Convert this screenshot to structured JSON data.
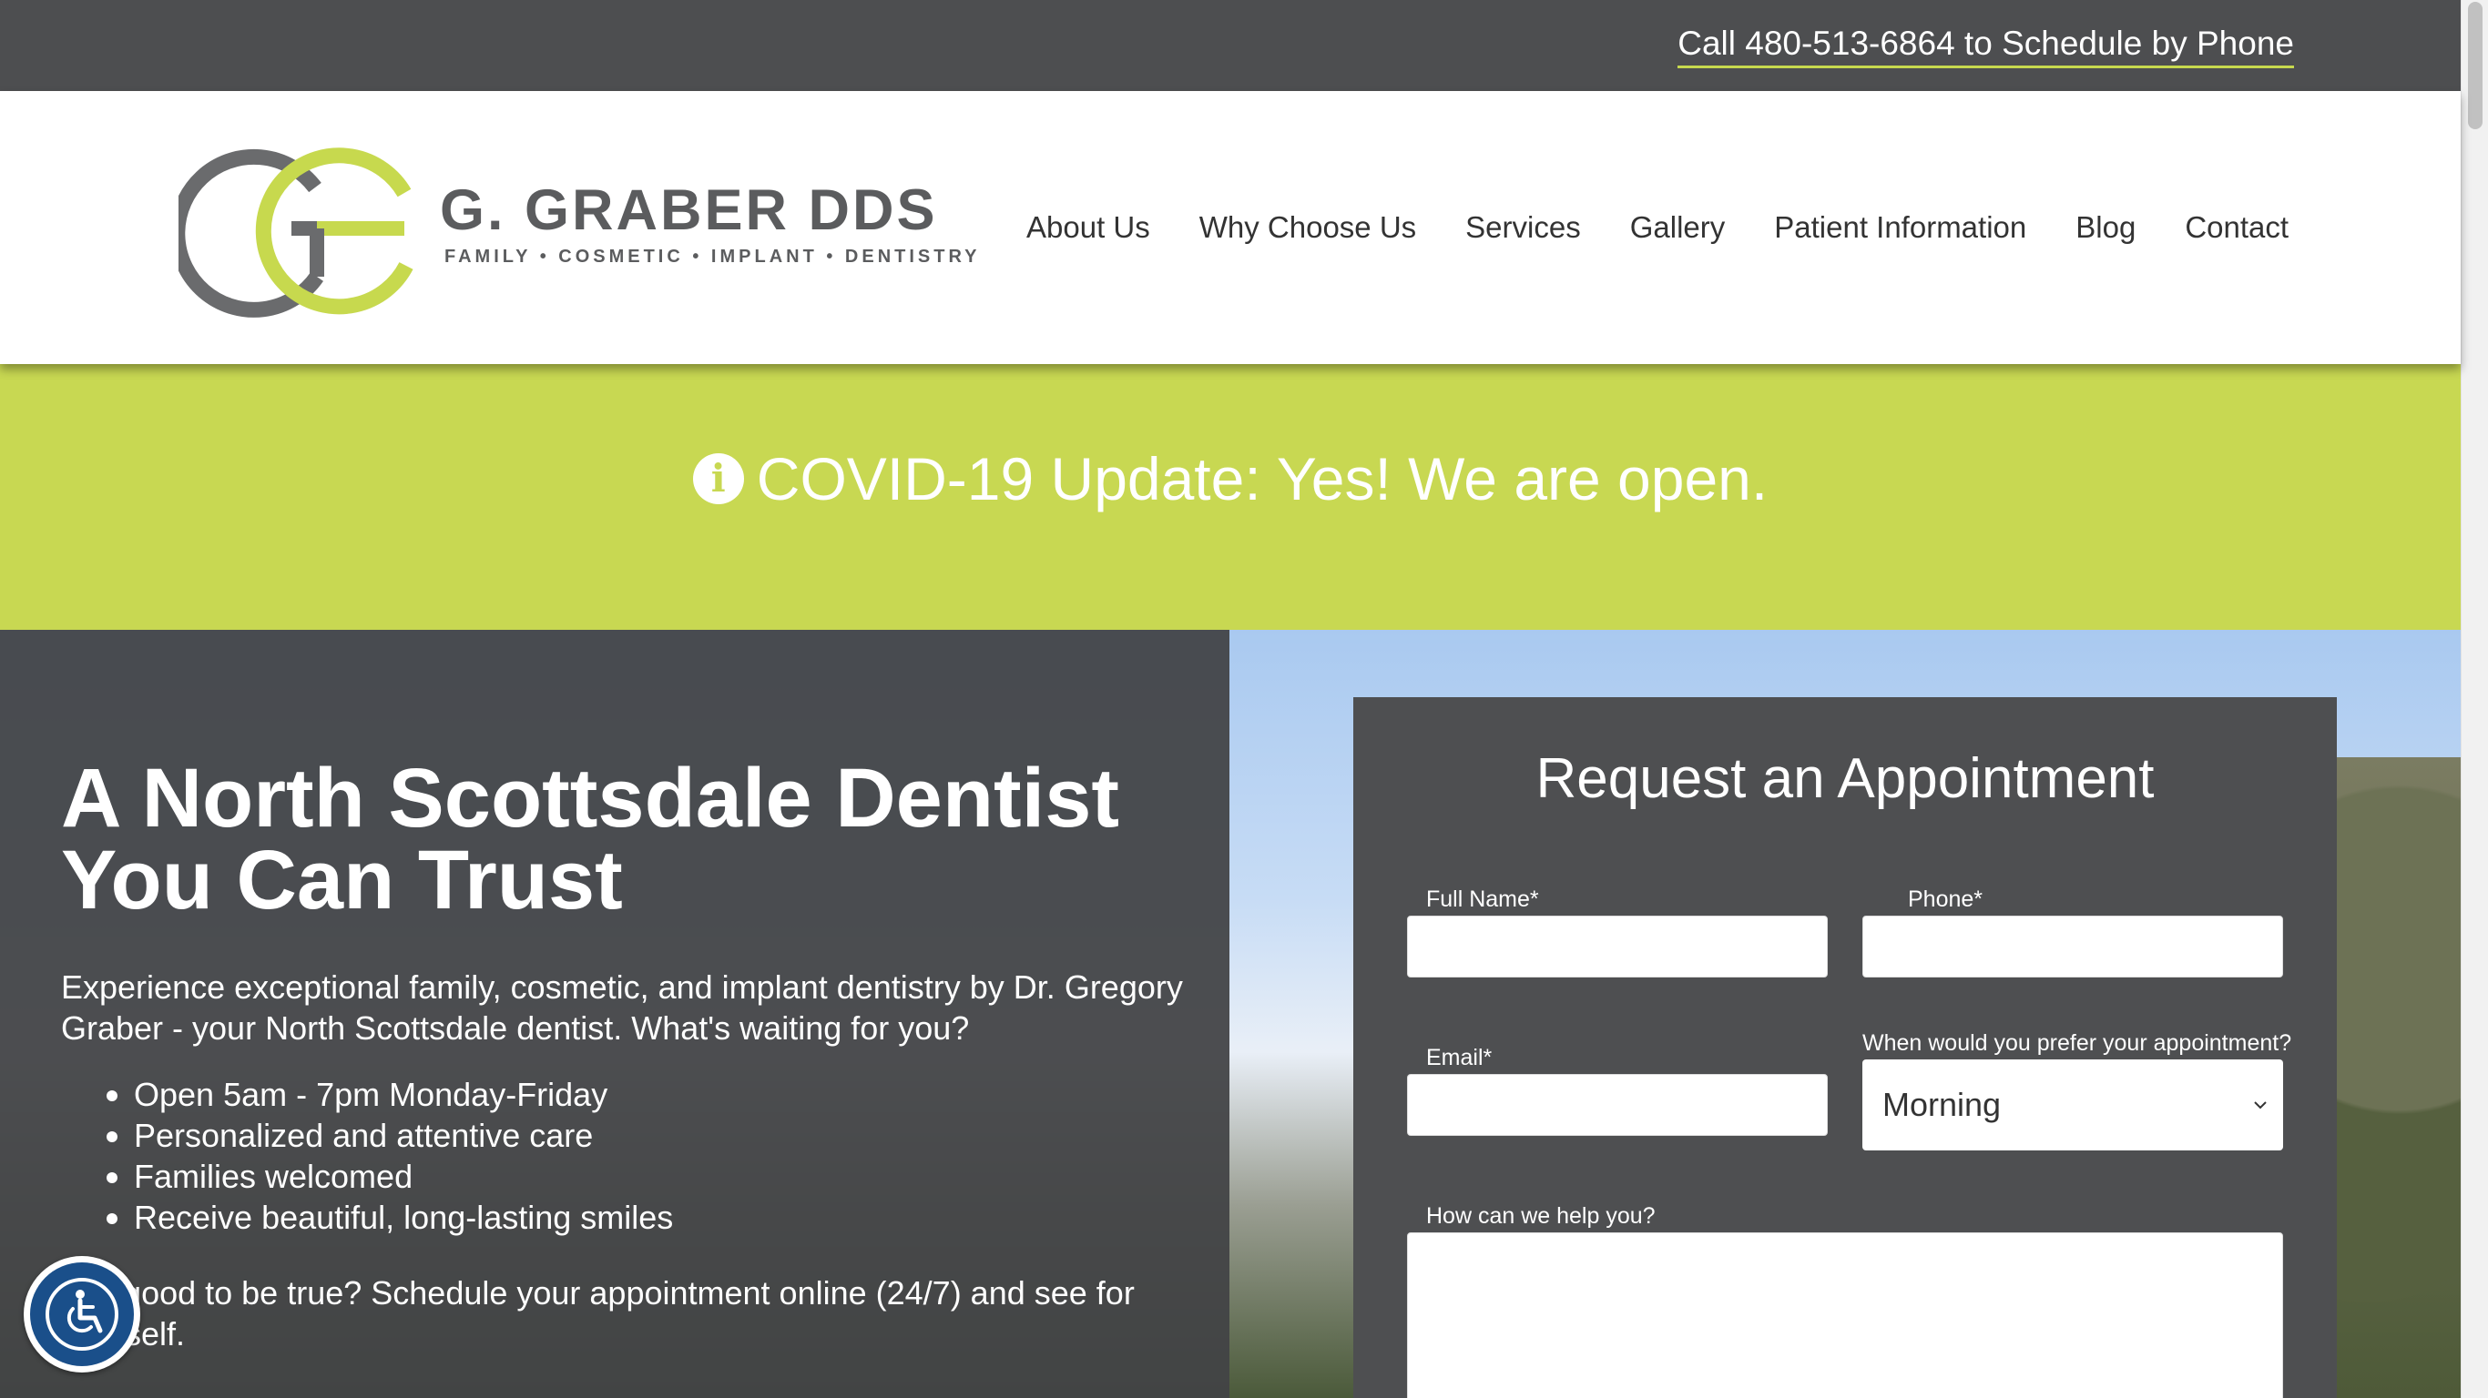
{
  "topbar": {
    "phone_cta": "Call 480-513-6864 to Schedule by Phone"
  },
  "logo": {
    "name": "G. GRABER DDS",
    "tagline": "FAMILY • COSMETIC • IMPLANT • DENTISTRY"
  },
  "nav": {
    "items": [
      {
        "label": "About Us"
      },
      {
        "label": "Why Choose Us"
      },
      {
        "label": "Services"
      },
      {
        "label": "Gallery"
      },
      {
        "label": "Patient Information"
      },
      {
        "label": "Blog"
      },
      {
        "label": "Contact"
      }
    ]
  },
  "covid": {
    "text": "COVID-19 Update: Yes! We are open."
  },
  "hero": {
    "title_line1": "A North Scottsdale Dentist",
    "title_line2": "You Can Trust",
    "intro": "Experience exceptional family, cosmetic, and implant dentistry by Dr. Gregory Graber - your North Scottsdale dentist. What's waiting for you?",
    "bullets": [
      "Open 5am - 7pm Monday-Friday",
      "Personalized and attentive care",
      "Families welcomed",
      "Receive beautiful, long-lasting smiles"
    ],
    "closing": "Too good to be true? Schedule your appointment online (24/7) and see for yourself."
  },
  "form": {
    "title": "Request an Appointment",
    "full_name_label": "Full Name*",
    "phone_label": "Phone*",
    "email_label": "Email*",
    "preference_label": "When would you prefer your appointment?",
    "preference_value": "Morning",
    "message_label": "How can we help you?",
    "full_name_value": "",
    "phone_value": "",
    "email_value": "",
    "message_value": ""
  },
  "colors": {
    "accent_green": "#c8d852",
    "dark_gray": "#4d4e50",
    "logo_gray": "#5b5c5e"
  }
}
